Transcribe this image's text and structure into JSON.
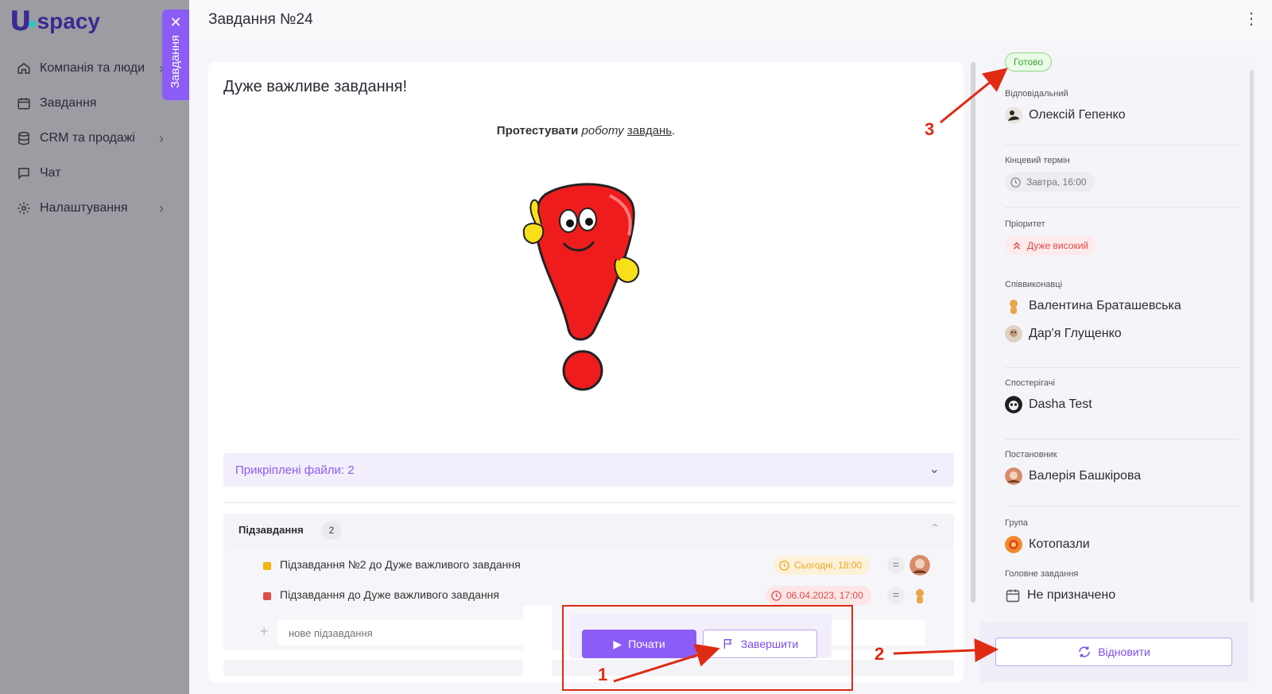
{
  "app": {
    "logo_u": "U",
    "logo_text": "spacy"
  },
  "sidebar": {
    "items": [
      {
        "label": "Компанія та люди",
        "icon": "home-icon",
        "has_chevron": true
      },
      {
        "label": "Завдання",
        "icon": "calendar-icon",
        "has_chevron": false
      },
      {
        "label": "CRM та продажі",
        "icon": "database-icon",
        "has_chevron": true
      },
      {
        "label": "Чат",
        "icon": "chat-icon",
        "has_chevron": false
      },
      {
        "label": "Налаштування",
        "icon": "gear-icon",
        "has_chevron": true
      }
    ],
    "drawer_tab": {
      "label": "Завдання",
      "close_glyph": "✕"
    }
  },
  "header": {
    "title": "Завдання №24",
    "menu_glyph": "⋮"
  },
  "task": {
    "heading": "Дуже важливе завдання!",
    "description": {
      "bold": "Протестувати",
      "italic": "роботу",
      "underline": "завдань",
      "end": "."
    },
    "image": "exclamation-mark-cartoon",
    "attachments_label": "Прикріплені файли: 2",
    "subtasks": {
      "label": "Підзавдання",
      "count": "2",
      "items": [
        {
          "title": "Підзавдання №2 до Дуже важливого завдання",
          "color": "#f2b50c",
          "deadline": "Сьогодні, 18:00",
          "deadline_bg": "#fdf1d9",
          "deadline_color": "#f0a624"
        },
        {
          "title": "Підзавдання до Дуже важливого завдання",
          "color": "#e14b4b",
          "deadline": "06.04.2023, 17:00",
          "deadline_bg": "#fde6e6",
          "deadline_color": "#e04a4a"
        }
      ],
      "new_placeholder": "нове підзавдання"
    },
    "actions": {
      "start": "Почати",
      "finish": "Завершити"
    }
  },
  "details": {
    "status": "Готово",
    "responsible": {
      "label": "Відповідальний",
      "name": "Олексій Гепенко"
    },
    "deadline": {
      "label": "Кінцевий термін",
      "value": "Завтра, 16:00"
    },
    "priority": {
      "label": "Пріоритет",
      "value": "Дуже високий"
    },
    "coexecutors": {
      "label": "Співвиконавці",
      "people": [
        "Валентина Браташевська",
        "Дар'я Глущенко"
      ]
    },
    "observers": {
      "label": "Спостерігачі",
      "people": [
        "Dasha Test"
      ]
    },
    "creator": {
      "label": "Постановник",
      "name": "Валерія Башкірова"
    },
    "group": {
      "label": "Група",
      "name": "Котопазли"
    },
    "parent_task": {
      "label": "Головне завдання",
      "value": "Не призначено"
    },
    "restore": "Відновити"
  },
  "annotations": {
    "n1": "1",
    "n2": "2",
    "n3": "3",
    "color": "#e02b14"
  },
  "colors": {
    "accent": "#8b5cf6",
    "sidebar_bg": "#9c9ca3",
    "status_green": "#3ea336",
    "priority_red": "#e04a4a"
  }
}
